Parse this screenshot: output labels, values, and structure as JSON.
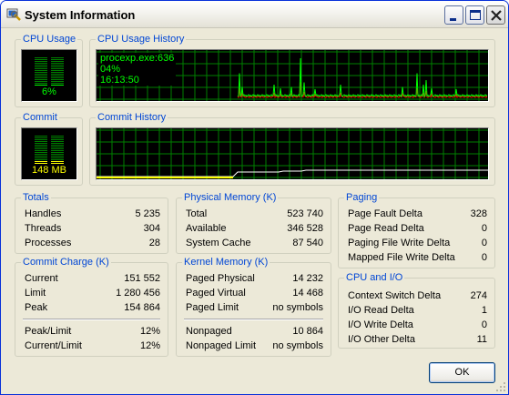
{
  "window": {
    "title": "System Information"
  },
  "cpu": {
    "usage_label": "CPU Usage",
    "usage_value": "6%",
    "usage_fraction": 0.06,
    "history_label": "CPU Usage History",
    "tooltip": {
      "process": "procexp.exe:636",
      "percent": "04%",
      "time": "16:13:50"
    }
  },
  "commit": {
    "label": "Commit",
    "value": "148 MB",
    "fraction": 0.12,
    "history_label": "Commit History"
  },
  "totals": {
    "label": "Totals",
    "rows": [
      {
        "label": "Handles",
        "value": "5 235"
      },
      {
        "label": "Threads",
        "value": "304"
      },
      {
        "label": "Processes",
        "value": "28"
      }
    ]
  },
  "commit_charge": {
    "label": "Commit Charge (K)",
    "rows": [
      {
        "label": "Current",
        "value": "151 552"
      },
      {
        "label": "Limit",
        "value": "1 280 456"
      },
      {
        "label": "Peak",
        "value": "154 864"
      }
    ],
    "ratio_rows": [
      {
        "label": "Peak/Limit",
        "value": "12%"
      },
      {
        "label": "Current/Limit",
        "value": "12%"
      }
    ]
  },
  "physical_memory": {
    "label": "Physical Memory (K)",
    "rows": [
      {
        "label": "Total",
        "value": "523 740"
      },
      {
        "label": "Available",
        "value": "346 528"
      },
      {
        "label": "System Cache",
        "value": "87 540"
      }
    ]
  },
  "kernel_memory": {
    "label": "Kernel Memory (K)",
    "rows": [
      {
        "label": "Paged Physical",
        "value": "14 232"
      },
      {
        "label": "Paged Virtual",
        "value": "14 468"
      },
      {
        "label": "Paged Limit",
        "value": "no symbols"
      }
    ],
    "nonpaged_rows": [
      {
        "label": "Nonpaged",
        "value": "10 864"
      },
      {
        "label": "Nonpaged Limit",
        "value": "no symbols"
      }
    ]
  },
  "paging": {
    "label": "Paging",
    "rows": [
      {
        "label": "Page Fault Delta",
        "value": "328"
      },
      {
        "label": "Page Read Delta",
        "value": "0"
      },
      {
        "label": "Paging File Write Delta",
        "value": "0"
      },
      {
        "label": "Mapped File Write Delta",
        "value": "0"
      }
    ]
  },
  "cpu_io": {
    "label": "CPU and I/O",
    "rows": [
      {
        "label": "Context Switch Delta",
        "value": "274"
      },
      {
        "label": "I/O Read Delta",
        "value": "1"
      },
      {
        "label": "I/O Write Delta",
        "value": "0"
      },
      {
        "label": "I/O Other Delta",
        "value": "11"
      }
    ]
  },
  "buttons": {
    "ok": "OK"
  },
  "colors": {
    "graph_bg": "#000000",
    "grid": "#008000",
    "cpu_line": "#00ff00",
    "kernel_line": "#ff0000",
    "commit_line": "#ffff00",
    "legend_text": "#0046d5"
  },
  "icons": [
    "app-icon",
    "minimize-icon",
    "maximize-icon",
    "close-icon",
    "size-grip-icon"
  ]
}
